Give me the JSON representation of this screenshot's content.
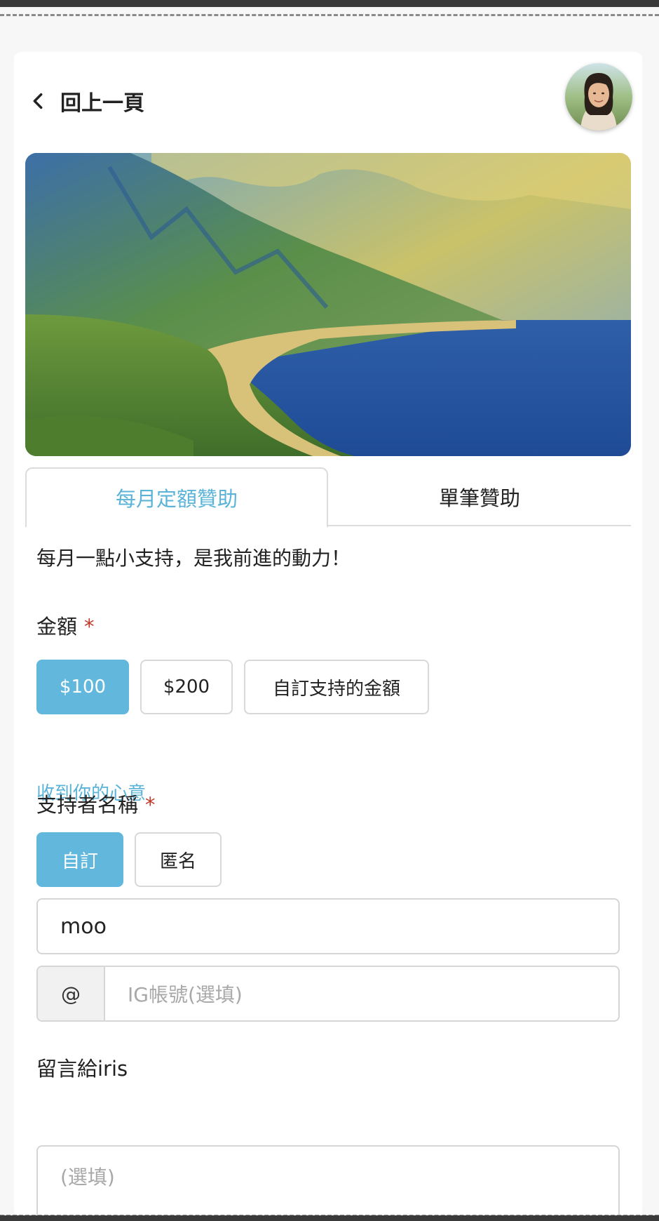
{
  "header": {
    "back_label": "回上一頁",
    "avatar_icon": "user-avatar"
  },
  "tabs": [
    {
      "label": "每月定額贊助",
      "active": true
    },
    {
      "label": "單筆贊助",
      "active": false
    }
  ],
  "tagline": "每月一點小支持，是我前進的動力！",
  "amount": {
    "label": "金額",
    "required_mark": "*",
    "options": [
      {
        "label": "$100",
        "selected": true
      },
      {
        "label": "$200",
        "selected": false
      },
      {
        "label": "自訂支持的金額",
        "selected": false
      }
    ],
    "hint": "收到你的心意"
  },
  "supporter": {
    "label": "支持者名稱",
    "required_mark": "*",
    "options": [
      {
        "label": "自訂",
        "selected": true
      },
      {
        "label": "匿名",
        "selected": false
      }
    ],
    "name_value": "moo",
    "ig_prefix": "@",
    "ig_placeholder": "IG帳號(選填)"
  },
  "message": {
    "label": "留言給iris",
    "placeholder": "(選填)"
  },
  "colors": {
    "accent": "#5bb4d8",
    "selected_button": "#62b7dc",
    "required": "#c0392b"
  }
}
